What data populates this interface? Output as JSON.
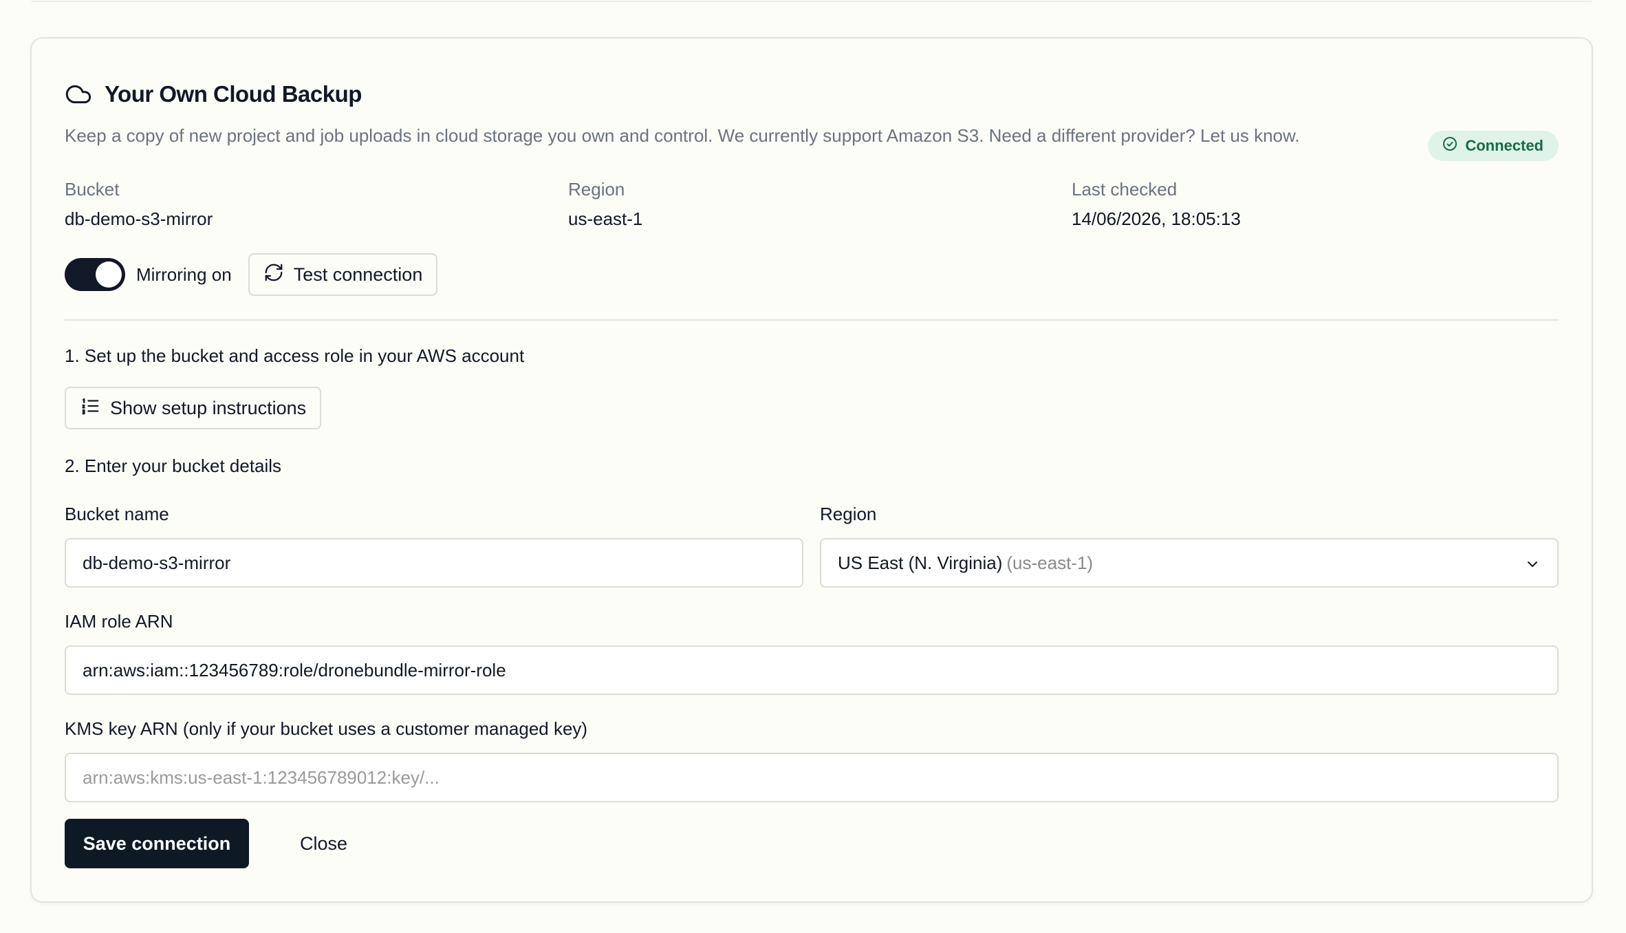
{
  "card": {
    "title": "Your Own Cloud Backup",
    "description": "Keep a copy of new project and job uploads in cloud storage you own and control. We currently support Amazon S3. Need a different provider? Let us know.",
    "status_badge": "Connected",
    "icon": "cloud-icon"
  },
  "summary": {
    "bucket_label": "Bucket",
    "bucket_value": "db-demo-s3-mirror",
    "region_label": "Region",
    "region_value": "us-east-1",
    "last_checked_label": "Last checked",
    "last_checked_value": "14/06/2026, 18:05:13"
  },
  "actions": {
    "mirroring_label": "Mirroring on",
    "mirroring_enabled": true,
    "test_connection_label": "Test connection"
  },
  "step1": {
    "heading": "1. Set up the bucket and access role in your AWS account",
    "show_instructions_label": "Show setup instructions"
  },
  "step2": {
    "heading": "2. Enter your bucket details",
    "bucket_name_label": "Bucket name",
    "bucket_name_value": "db-demo-s3-mirror",
    "region_label": "Region",
    "region_selected_name": "US East (N. Virginia)",
    "region_selected_code": "(us-east-1)",
    "iam_label": "IAM role ARN",
    "iam_value": "arn:aws:iam::123456789:role/dronebundle-mirror-role",
    "kms_label": "KMS key ARN (only if your bucket uses a customer managed key)",
    "kms_placeholder": "arn:aws:kms:us-east-1:123456789012:key/..."
  },
  "footer": {
    "save_label": "Save connection",
    "close_label": "Close"
  },
  "colors": {
    "primary": "#0d1a26",
    "success_bg": "#dff3e8",
    "success_text": "#176b45",
    "muted_text": "#6b7280"
  }
}
